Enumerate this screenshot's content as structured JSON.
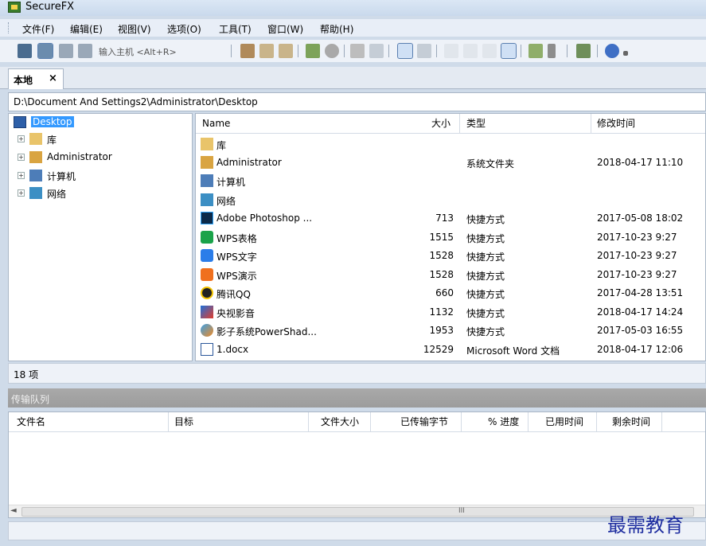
{
  "window": {
    "title": "SecureFX"
  },
  "menu": [
    "文件(F)",
    "编辑(E)",
    "视图(V)",
    "选项(O)",
    "工具(T)",
    "窗口(W)",
    "帮助(H)"
  ],
  "toolbar": {
    "host_placeholder": "输入主机 <Alt+R>"
  },
  "tab": {
    "label": "本地",
    "close": "×"
  },
  "path": "D:\\Document And Settings2\\Administrator\\Desktop",
  "tree": [
    {
      "label": "Desktop",
      "selected": true,
      "icon": "desktop-icon"
    },
    {
      "label": "库",
      "icon": "library-icon"
    },
    {
      "label": "Administrator",
      "icon": "user-folder-icon"
    },
    {
      "label": "计算机",
      "icon": "computer-icon"
    },
    {
      "label": "网络",
      "icon": "network-icon"
    }
  ],
  "columns": {
    "name": "Name",
    "size": "大小",
    "type": "类型",
    "modified": "修改时间"
  },
  "files": [
    {
      "name": "库",
      "size": "",
      "type": "",
      "modified": "",
      "icon": "library-icon"
    },
    {
      "name": "Administrator",
      "size": "",
      "type": "系统文件夹",
      "modified": "2018-04-17 11:10",
      "icon": "user-folder-icon"
    },
    {
      "name": "计算机",
      "size": "",
      "type": "",
      "modified": "",
      "icon": "computer-icon"
    },
    {
      "name": "网络",
      "size": "",
      "type": "",
      "modified": "",
      "icon": "network-icon"
    },
    {
      "name": "Adobe Photoshop ...",
      "size": "713",
      "type": "快捷方式",
      "modified": "2017-05-08 18:02",
      "icon": "photoshop-icon"
    },
    {
      "name": "WPS表格",
      "size": "1515",
      "type": "快捷方式",
      "modified": "2017-10-23 9:27",
      "icon": "wps-spreadsheet-icon"
    },
    {
      "name": "WPS文字",
      "size": "1528",
      "type": "快捷方式",
      "modified": "2017-10-23 9:27",
      "icon": "wps-writer-icon"
    },
    {
      "name": "WPS演示",
      "size": "1528",
      "type": "快捷方式",
      "modified": "2017-10-23 9:27",
      "icon": "wps-presentation-icon"
    },
    {
      "name": "腾讯QQ",
      "size": "660",
      "type": "快捷方式",
      "modified": "2017-04-28 13:51",
      "icon": "qq-icon"
    },
    {
      "name": "央视影音",
      "size": "1132",
      "type": "快捷方式",
      "modified": "2018-04-17 14:24",
      "icon": "cbox-icon"
    },
    {
      "name": "影子系统PowerShad...",
      "size": "1953",
      "type": "快捷方式",
      "modified": "2017-05-03 16:55",
      "icon": "powershadow-icon"
    },
    {
      "name": "1.docx",
      "size": "12529",
      "type": "Microsoft Word 文档",
      "modified": "2018-04-17 12:06",
      "icon": "word-doc-icon"
    }
  ],
  "status": "18 项",
  "queue": {
    "title": "传输队列",
    "columns": [
      "文件名",
      "目标",
      "文件大小",
      "已传输字节",
      "% 进度",
      "已用时间",
      "剩余时间"
    ],
    "scroll_grip": "III"
  },
  "watermark": "最需教育"
}
